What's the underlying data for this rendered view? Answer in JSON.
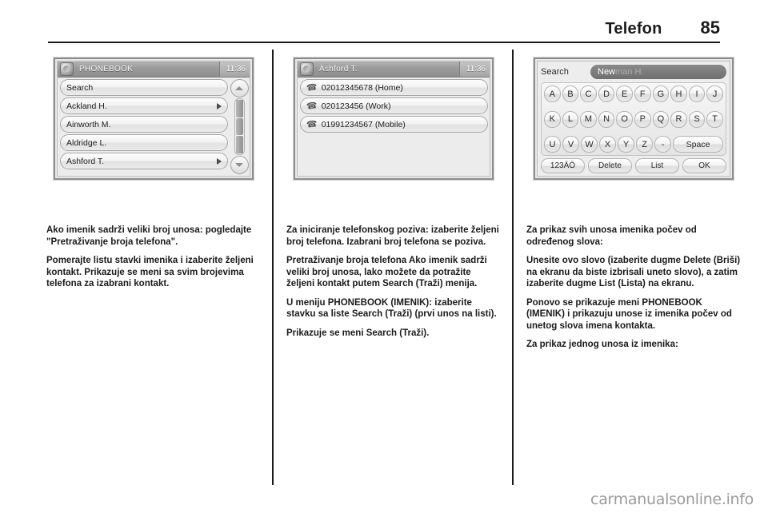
{
  "header": {
    "title": "Telefon",
    "page_number": "85"
  },
  "figures": {
    "phonebook": {
      "titlebar": {
        "icon": "globe-icon",
        "title": "PHONEBOOK",
        "clock": "11:36"
      },
      "rows": [
        {
          "label": "Search",
          "arrow": false
        },
        {
          "label": "Ackland H.",
          "arrow": true
        },
        {
          "label": "Ainworth M.",
          "arrow": false
        },
        {
          "label": "Aldridge L.",
          "arrow": false
        },
        {
          "label": "Ashford T.",
          "arrow": true
        }
      ],
      "scrollbar": {
        "up": "chevron-up-icon",
        "down": "chevron-down-icon"
      }
    },
    "contact": {
      "titlebar": {
        "icon": "globe-icon",
        "title": "Ashford T.",
        "clock": "11:36"
      },
      "rows": [
        {
          "label": "02012345678 (Home)"
        },
        {
          "label": "020123456 (Work)"
        },
        {
          "label": "01991234567 (Mobile)"
        }
      ]
    },
    "keyboard": {
      "search_label": "Search",
      "field_typed": "New",
      "field_suggestion": "man H.",
      "rows": [
        [
          "A",
          "B",
          "C",
          "D",
          "E",
          "F",
          "G",
          "H",
          "I",
          "J"
        ],
        [
          "K",
          "L",
          "M",
          "N",
          "O",
          "P",
          "Q",
          "R",
          "S",
          "T"
        ],
        [
          "U",
          "V",
          "W",
          "X",
          "Y",
          "Z",
          "-"
        ]
      ],
      "space_label": "Space",
      "bottom_row": [
        "123ÄÖ",
        "Delete",
        "List",
        "OK"
      ]
    }
  },
  "columns": {
    "left": [
      "Ako imenik sadrži veliki broj unosa: pogledajte \"Pretraživanje broja telefona\".",
      "Pomerajte listu stavki imenika i izaberite željeni kontakt. Prikazuje se meni sa svim brojevima telefona za izabrani kontakt."
    ],
    "middle": [
      "Za iniciranje telefonskog poziva: izaberite željeni broj telefona. Izabrani broj telefona se poziva.",
      "Pretraživanje broja telefona Ako imenik sadrži veliki broj unosa, lako možete da potražite željeni kontakt putem Search (Traži) menija.",
      "U meniju PHONEBOOK (IMENIK): izaberite stavku sa liste Search (Traži) (prvi unos na listi).",
      "Prikazuje se meni Search (Traži)."
    ],
    "right": [
      "Za prikaz svih unosa imenika počev od određenog slova:",
      "Unesite ovo slovo (izaberite dugme Delete (Briši) na ekranu da biste izbrisali uneto slovo), a zatim izaberite dugme List (Lista) na ekranu.",
      "Ponovo se prikazuje meni PHONEBOOK (IMENIK) i prikazuju unose iz imenika počev od unetog slova imena kontakta.",
      "Za prikaz jednog unosa iz imenika:"
    ]
  },
  "watermark": "carmanualsonline.info"
}
